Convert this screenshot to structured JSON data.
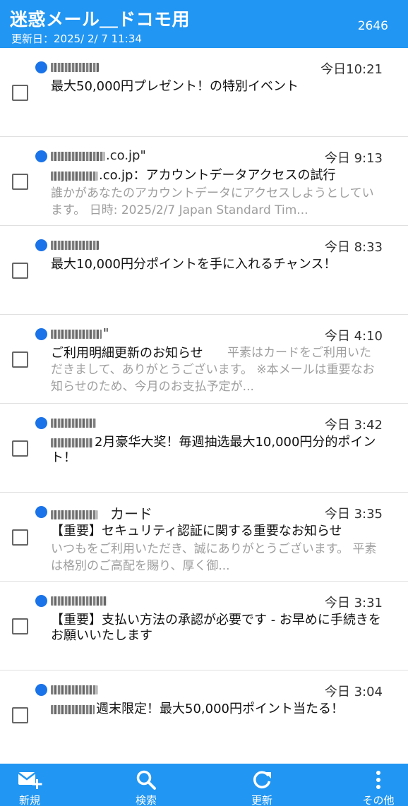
{
  "header": {
    "title": "迷惑メール＿ドコモ用",
    "updated": "更新日：2025/ 2/ 7 11:34",
    "count": "2646"
  },
  "messages": [
    {
      "sender": "",
      "time": "今日10:21",
      "subject": "最大50,000円プレゼント！の特別イベント",
      "preview": ""
    },
    {
      "sender": ".co.jp\"",
      "time": "今日 9:13",
      "subject": ".co.jp：アカウントデータアクセスの試行",
      "preview": "誰かがあなたのアカウントデータにアクセスしようとしています。 日時: 2025/2/7 Japan Standard Tim..."
    },
    {
      "sender": "",
      "time": "今日 8:33",
      "subject": "最大10,000円分ポイントを手に入れるチャンス！",
      "preview": ""
    },
    {
      "sender": "\"",
      "time": "今日 4:10",
      "subject": "ご利用明細更新のお知らせ",
      "preview": "平素はカードをご利用いただきまして、ありがとうございます。 ※本メールは重要なお知らせのため、今月のお支払予定が..."
    },
    {
      "sender": "",
      "time": "今日 3:42",
      "subject": "2月豪华大奖！毎週抽选最大10,000円分的ポイント！",
      "preview": ""
    },
    {
      "sender": "カード",
      "time": "今日 3:35",
      "subject": "【重要】セキュリティ認証に関する重要なお知らせ",
      "preview": "いつもをご利用いただき、誠にありがとうございます。 平素は格別のご高配を賜り、厚く御..."
    },
    {
      "sender": "",
      "time": "今日 3:31",
      "subject": "【重要】支払い方法の承認が必要です - お早めに手続きをお願いいたします",
      "preview": ""
    },
    {
      "sender": "",
      "time": "今日 3:04",
      "subject": "週末限定！最大50,000円ポイント当たる！",
      "preview": ""
    }
  ],
  "bottom": {
    "new_label": "新規",
    "search_label": "検索",
    "refresh_label": "更新",
    "other_label": "その他"
  },
  "colors": {
    "accent": "#2196f3",
    "unread_dot": "#1a73e8",
    "preview_text": "#9e9e9e"
  }
}
